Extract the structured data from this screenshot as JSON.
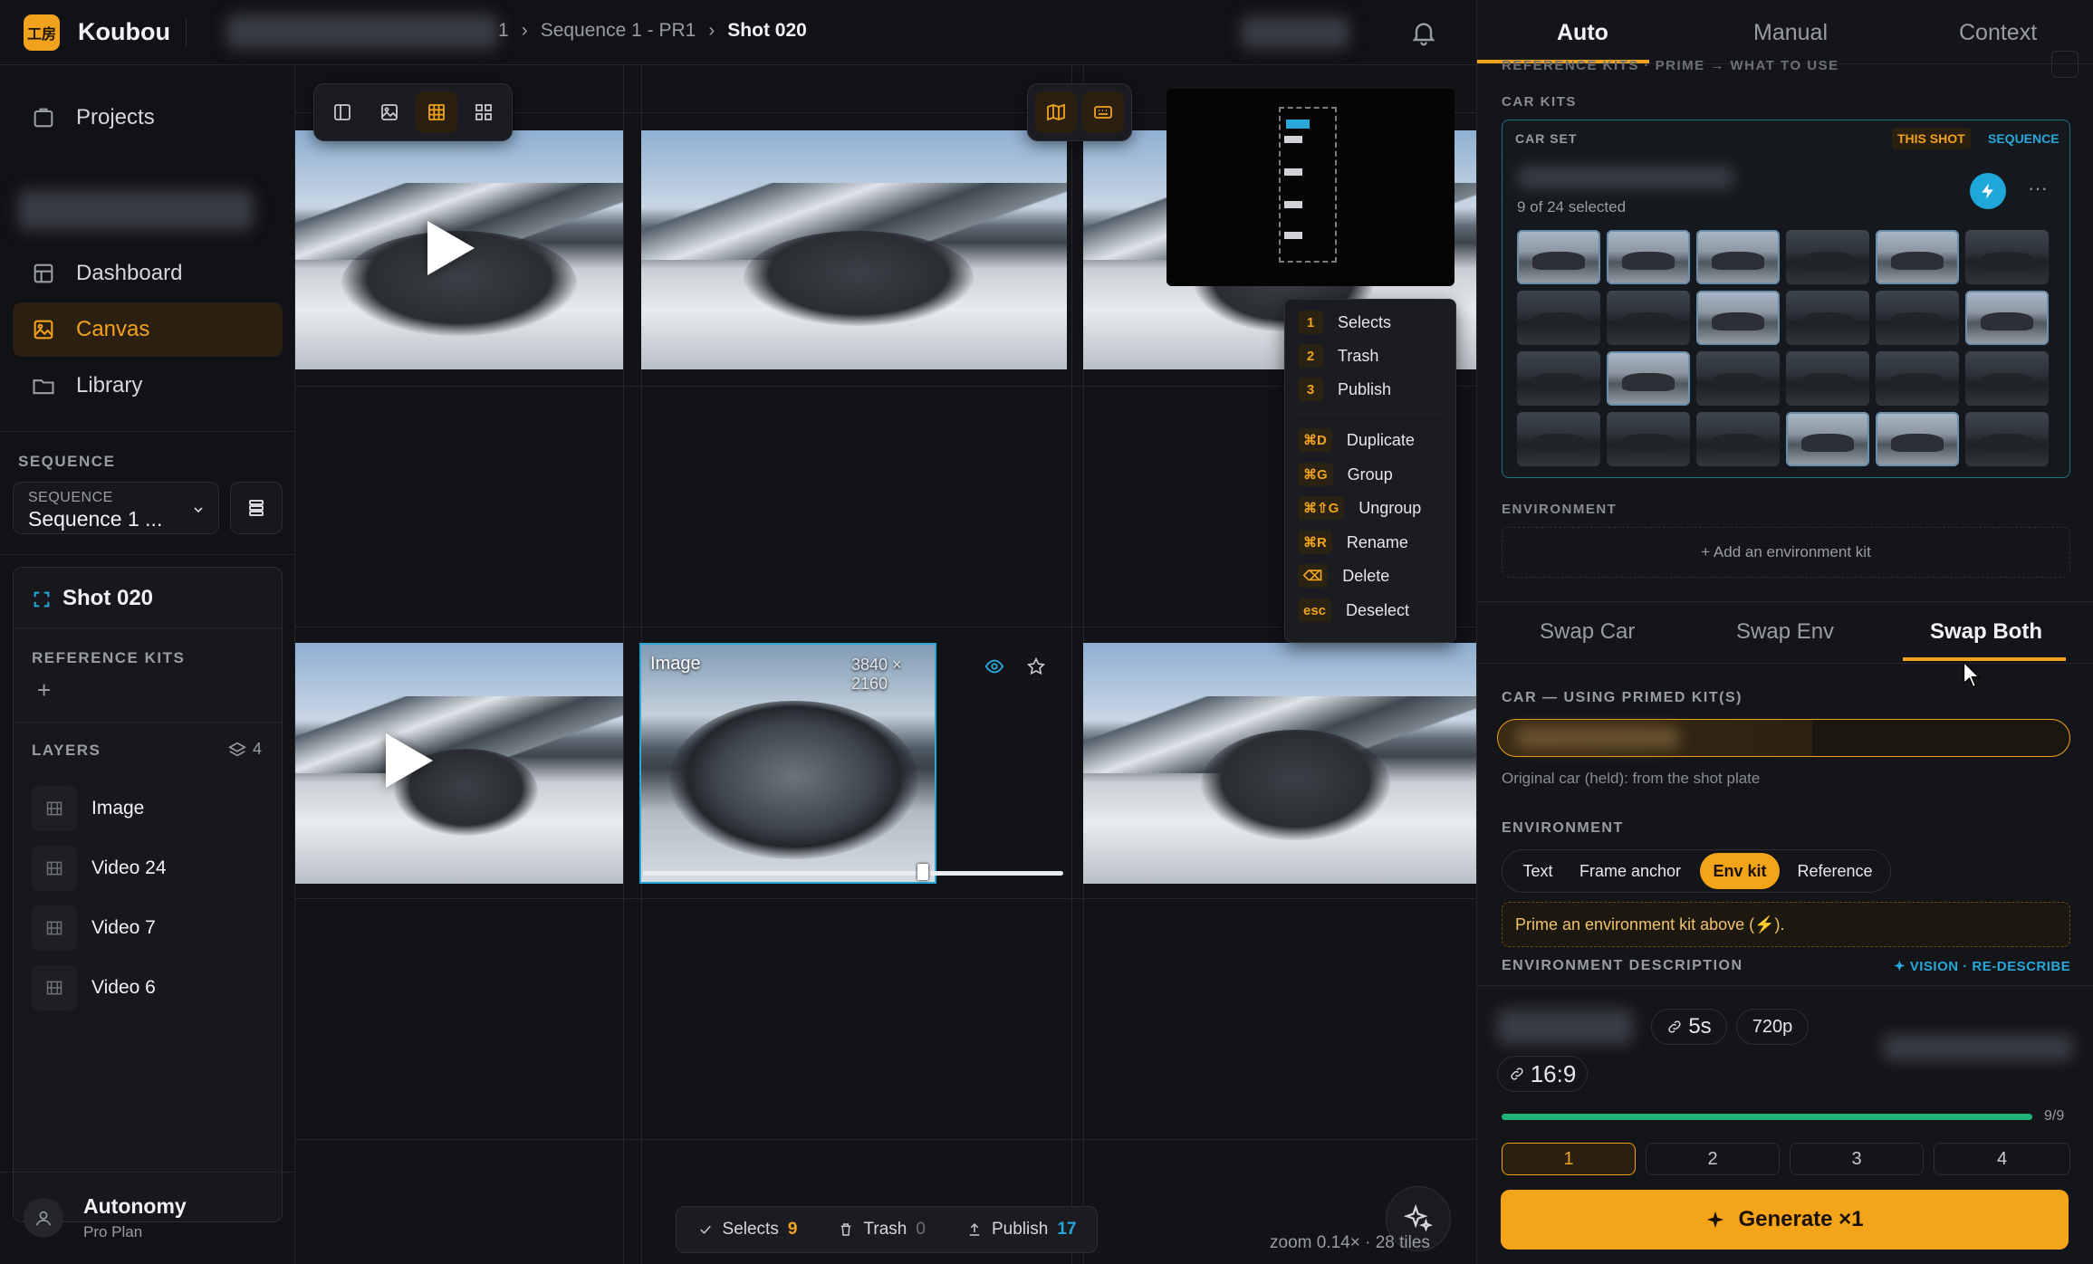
{
  "app": {
    "logo_text": "工房",
    "name": "Koubou"
  },
  "breadcrumb": {
    "partial": "1",
    "sep": "›",
    "sequence": "Sequence 1 - PR1",
    "shot": "Shot 020"
  },
  "sidebar": {
    "nav": [
      {
        "label": "Projects"
      },
      {
        "label": "Dashboard"
      },
      {
        "label": "Canvas"
      },
      {
        "label": "Library"
      }
    ],
    "sequence_heading": "SEQUENCE",
    "sequence_select": {
      "label": "SEQUENCE",
      "value": "Sequence 1 ..."
    },
    "shot_title": "Shot 020",
    "reference_kits_heading": "REFERENCE KITS",
    "add": "+",
    "layers_heading": "LAYERS",
    "layers_count": "4",
    "layers": [
      {
        "label": "Image"
      },
      {
        "label": "Video 24"
      },
      {
        "label": "Video 7"
      },
      {
        "label": "Video 6"
      }
    ],
    "user": {
      "name": "Autonomy",
      "plan": "Pro Plan"
    }
  },
  "canvas": {
    "selected_tile": {
      "label": "Image",
      "dims": "3840 × 2160",
      "scrub": 0.67
    },
    "context_menu": [
      {
        "key": "1",
        "label": "Selects"
      },
      {
        "key": "2",
        "label": "Trash"
      },
      {
        "key": "3",
        "label": "Publish"
      },
      {
        "key": "⌘D",
        "label": "Duplicate"
      },
      {
        "key": "⌘G",
        "label": "Group"
      },
      {
        "key": "⌘⇧G",
        "label": "Ungroup"
      },
      {
        "key": "⌘R",
        "label": "Rename"
      },
      {
        "key": "⌫",
        "label": "Delete"
      },
      {
        "key": "esc",
        "label": "Deselect"
      }
    ],
    "bottombar": {
      "selects_label": "Selects",
      "selects_count": "9",
      "trash_label": "Trash",
      "trash_count": "0",
      "publish_label": "Publish",
      "publish_count": "17"
    },
    "zoom_text": "zoom 0.14× · 28 tiles"
  },
  "right": {
    "tabs": [
      {
        "label": "Auto"
      },
      {
        "label": "Manual"
      },
      {
        "label": "Context"
      }
    ],
    "active_tab": "Auto",
    "ref_heading": "REFERENCE KITS · PRIME → WHAT TO USE",
    "car_kits_heading": "CAR KITS",
    "car_set": {
      "label": "CAR SET",
      "this_shot": "THIS SHOT",
      "sequence": "SEQUENCE",
      "selected_text": "9 of 24 selected",
      "more": "···"
    },
    "environment_heading": "ENVIRONMENT",
    "add_env": "+ Add an environment kit",
    "swap_tabs": [
      {
        "label": "Swap Car"
      },
      {
        "label": "Swap Env"
      },
      {
        "label": "Swap Both"
      }
    ],
    "active_swap": "Swap Both",
    "car_heading": "CAR — USING PRIMED KIT(S)",
    "original_car": "Original car (held): from the shot plate",
    "env_heading": "ENVIRONMENT",
    "env_modes": [
      {
        "label": "Text"
      },
      {
        "label": "Frame anchor"
      },
      {
        "label": "Env kit"
      },
      {
        "label": "Reference"
      }
    ],
    "active_env_mode": "Env kit",
    "prime_notice": "Prime an environment kit above (⚡).",
    "env_desc_heading": "ENVIRONMENT DESCRIPTION",
    "vision_link": "✦ VISION · RE-DESCRIBE",
    "duration": "5s",
    "resolution": "720p",
    "aspect": "16:9",
    "progress": {
      "value": 1.0,
      "text": "9/9"
    },
    "counts": [
      {
        "label": "1"
      },
      {
        "label": "2"
      },
      {
        "label": "3"
      },
      {
        "label": "4"
      }
    ],
    "generate_label": "Generate ×1"
  },
  "colors": {
    "accent": "#f0a21c",
    "selection": "#27a8d8",
    "progress": "#1fb37a"
  }
}
